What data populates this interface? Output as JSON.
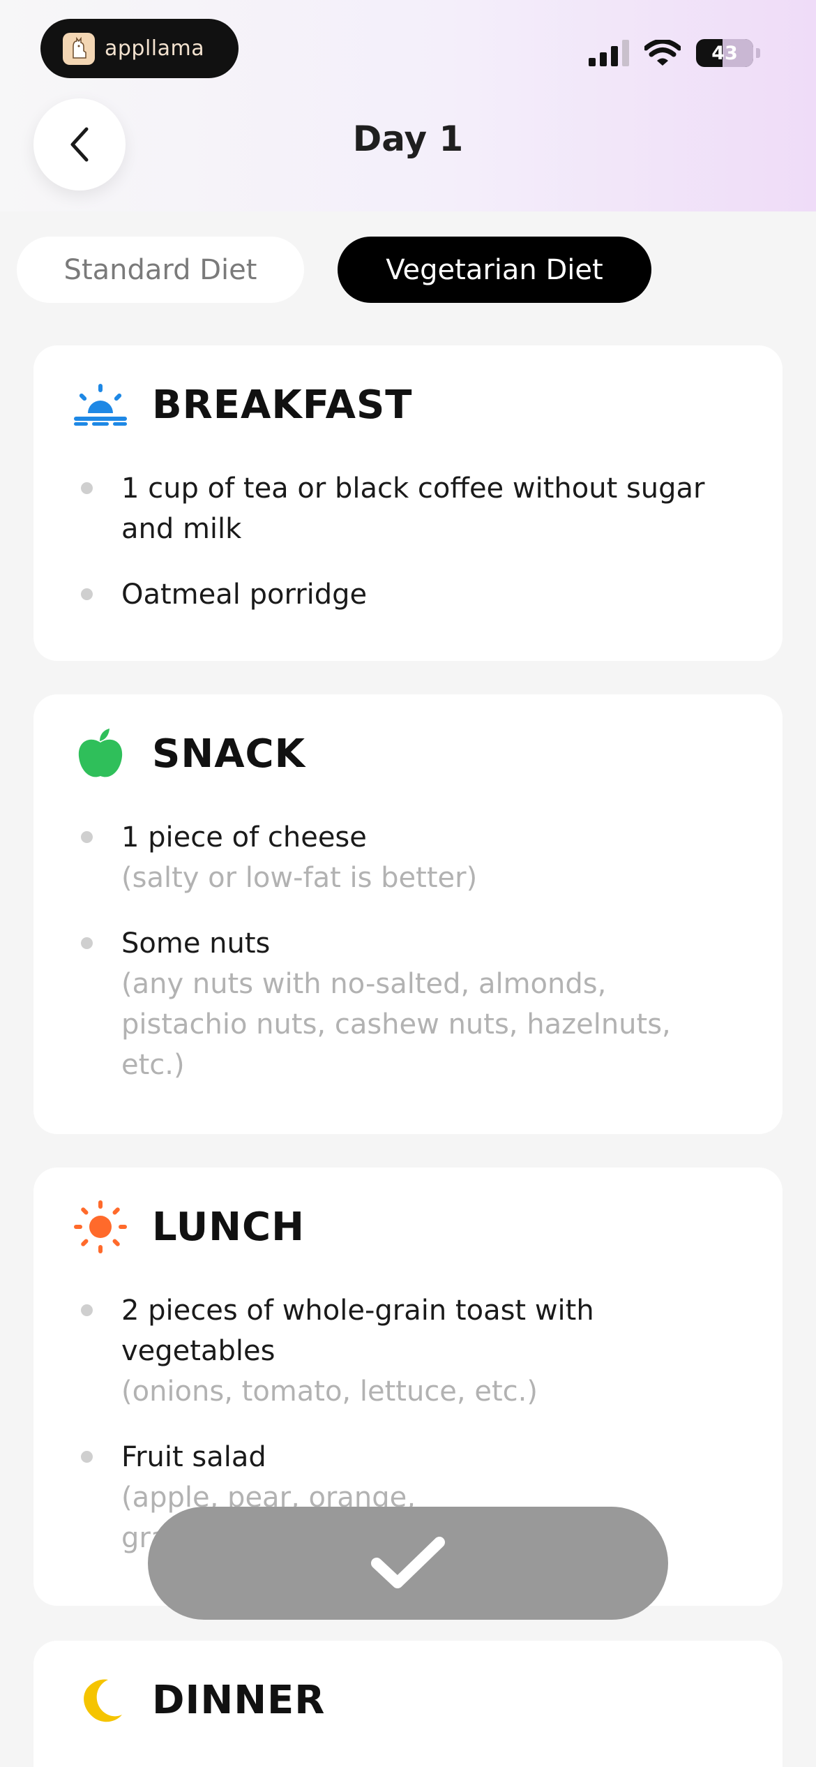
{
  "status_bar": {
    "brand_name": "appllama",
    "battery": "43"
  },
  "header": {
    "title": "Day 1"
  },
  "tabs": [
    {
      "label": "Standard Diet",
      "active": false
    },
    {
      "label": "Vegetarian Diet",
      "active": true
    }
  ],
  "meals": {
    "breakfast": {
      "title": "BREAKFAST",
      "icon": "sunrise-icon",
      "items": [
        {
          "main": "1 cup of tea or black coffee without sugar and milk"
        },
        {
          "main": "Oatmeal porridge"
        }
      ]
    },
    "snack": {
      "title": "SNACK",
      "icon": "apple-icon",
      "items": [
        {
          "main": "1 piece of cheese",
          "note": "(salty or low-fat is better)"
        },
        {
          "main": "Some nuts",
          "note": "(any nuts with no-salted, almonds, pistachio nuts, cashew nuts, hazelnuts, etc.)"
        }
      ]
    },
    "lunch": {
      "title": "LUNCH",
      "icon": "sun-icon",
      "items": [
        {
          "main": "2 pieces of whole-grain toast with vegetables",
          "note": "(onions, tomato, lettuce, etc.)"
        },
        {
          "main": "Fruit salad",
          "note": "(apple, pear, orange, grapes, etc.)"
        }
      ]
    },
    "dinner": {
      "title": "DINNER",
      "icon": "moon-icon"
    }
  },
  "colors": {
    "accent_dark": "#000000",
    "breakfast_icon": "#1e88e5",
    "snack_icon": "#2fbf5a",
    "lunch_icon": "#ff6a2b",
    "dinner_icon": "#f5c400",
    "confirm_button": "#999999"
  }
}
